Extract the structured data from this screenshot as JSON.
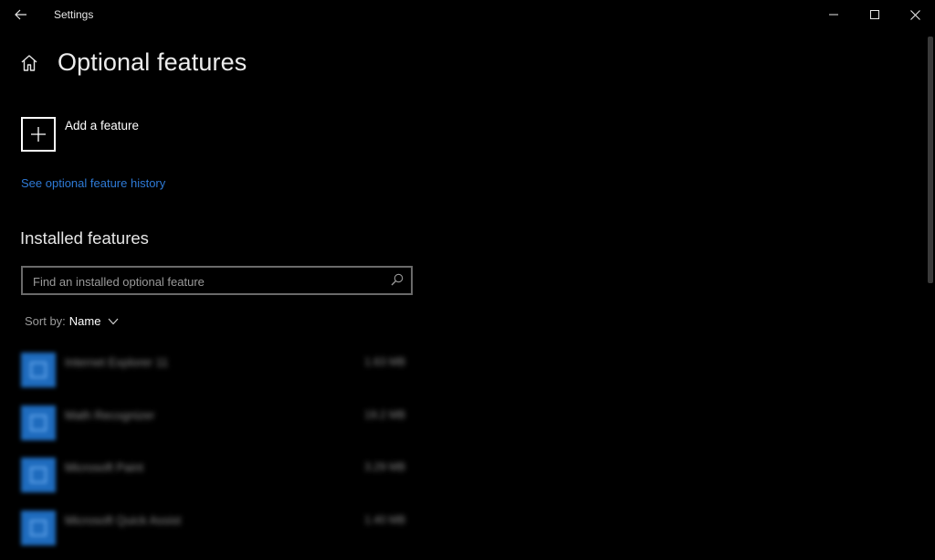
{
  "window": {
    "title": "Settings",
    "back_icon": "arrow-left-icon",
    "controls": [
      "minimize-icon",
      "maximize-icon",
      "close-icon"
    ]
  },
  "header": {
    "home_icon": "home-icon",
    "title": "Optional features"
  },
  "add_feature": {
    "icon": "plus-icon",
    "label": "Add a feature"
  },
  "history_link": "See optional feature history",
  "installed": {
    "title": "Installed features",
    "search_placeholder": "Find an installed optional feature",
    "search_icon": "search-icon",
    "sort_label": "Sort by:",
    "sort_value": "Name",
    "features": [
      {
        "name": "Internet Explorer 11",
        "size": "1.63 MB"
      },
      {
        "name": "Math Recognizer",
        "size": "19.2 MB"
      },
      {
        "name": "Microsoft Paint",
        "size": "3.29 MB"
      },
      {
        "name": "Microsoft Quick Assist",
        "size": "1.40 MB"
      }
    ]
  },
  "colors": {
    "background": "#000000",
    "accent_link": "#2e7ad6",
    "feature_icon": "#1e6bbd"
  }
}
